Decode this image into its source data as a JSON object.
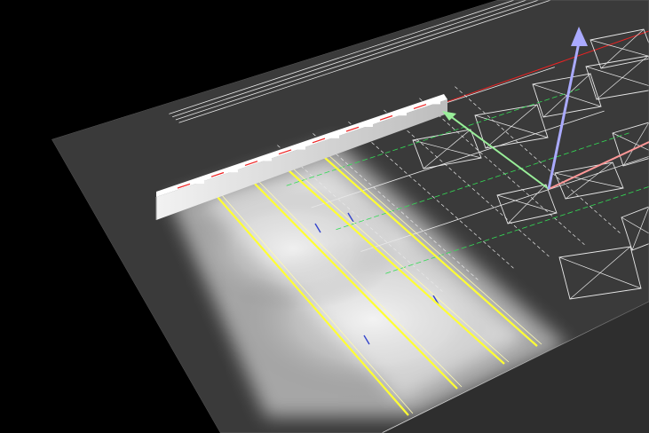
{
  "viewport": {
    "background": "#000000",
    "floor_color": "#3a3a3a",
    "linework_color": "#e8e8e8",
    "light_line_color": "#ffff33",
    "cad_green": "#33dd55",
    "cad_red": "#ee2222",
    "cad_blue": "#3344cc"
  },
  "gizmo": {
    "x_axis_color": "#ff9999",
    "y_axis_color": "#99ee99",
    "z_axis_color": "#aaaaff"
  },
  "icons": [
    "transform-gizmo-icon"
  ]
}
